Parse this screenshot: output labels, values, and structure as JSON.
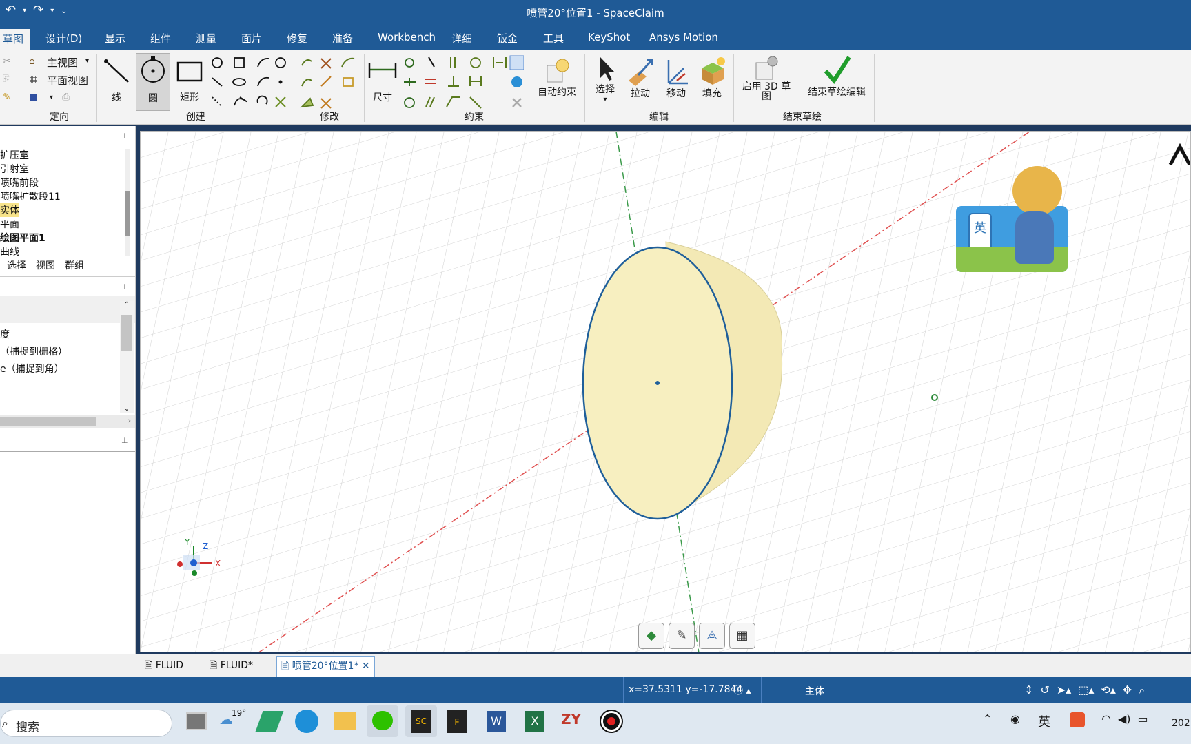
{
  "window": {
    "title": "喷管20°位置1 - SpaceClaim"
  },
  "tabs": [
    "草图",
    "设计(D)",
    "显示",
    "组件",
    "测量",
    "面片",
    "修复",
    "准备",
    "Workbench",
    "详细",
    "钣金",
    "工具",
    "KeyShot",
    "Ansys Motion"
  ],
  "ribbon": {
    "orient": {
      "main_view": "主视图",
      "plan_view": "平面视图",
      "group": "定向"
    },
    "create": {
      "line": "线",
      "circle": "圆",
      "rect": "矩形",
      "group": "创建"
    },
    "modify": {
      "group": "修改"
    },
    "constraint": {
      "dimension": "尺寸",
      "auto": "自动约束",
      "group": "约束"
    },
    "edit": {
      "select": "选择",
      "pull": "拉动",
      "move": "移动",
      "fill": "填充",
      "group": "编辑"
    },
    "finish": {
      "enable3d": "启用 3D 草图",
      "end": "结束草绘编辑",
      "group": "结束草绘"
    }
  },
  "tree": {
    "items": [
      "扩压室",
      "引射室",
      "喷嘴前段",
      "喷嘴扩散段11",
      "实体",
      "平面",
      "绘图平面1",
      "曲线"
    ],
    "bottom_tabs": [
      "选择",
      "视图",
      "群组"
    ]
  },
  "options": {
    "items": [
      "度",
      "（捕捉到栅格）",
      "e（捕捉到角）"
    ]
  },
  "doc_tabs": [
    "FLUID",
    "FLUID*",
    "喷管20°位置1*"
  ],
  "status": {
    "coords": "x=37.5311  y=-17.7844",
    "body": "主体"
  },
  "taskbar": {
    "search_placeholder": "搜索",
    "weather": "19°",
    "ime": "英",
    "time": "202"
  },
  "overlay": {
    "ime_badge": "英"
  },
  "axes": {
    "x": "X",
    "y": "Y",
    "z": "Z"
  }
}
